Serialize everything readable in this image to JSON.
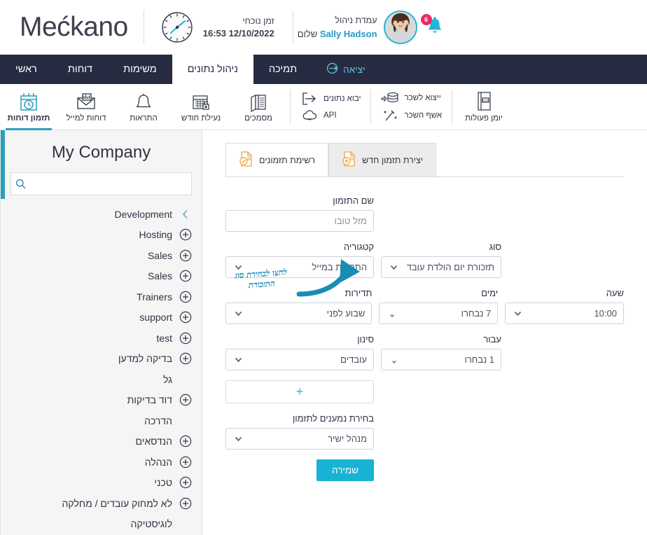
{
  "header": {
    "brand": "Mećkano",
    "clock": {
      "label": "זמן נוכחי",
      "value": "16:53 12/10/2022",
      "icon": "clock-icon"
    },
    "user": {
      "line1": "עמדת ניהול",
      "greeting": "שלום",
      "name": "Sally Hadson",
      "avatar_icon": "user-avatar",
      "bell_icon": "bell-icon",
      "notification_count": "6"
    }
  },
  "nav": {
    "items": [
      {
        "label": "ראשי",
        "active": false
      },
      {
        "label": "דוחות",
        "active": false
      },
      {
        "label": "משימות",
        "active": false
      },
      {
        "label": "ניהול נתונים",
        "active": true
      },
      {
        "label": "תמיכה",
        "active": false
      }
    ],
    "exit": {
      "label": "יציאה",
      "icon": "logout-icon"
    }
  },
  "toolbar": {
    "items": [
      {
        "label": "תזמון דוחות",
        "icon": "calendar-clock-icon",
        "active": true
      },
      {
        "label": "דוחות למייל",
        "icon": "mail-report-icon",
        "active": false
      },
      {
        "label": "התראות",
        "icon": "bell-icon",
        "active": false
      },
      {
        "label": "נעילת חודש",
        "icon": "calendar-lock-icon",
        "active": false
      },
      {
        "label": "מסמכים",
        "icon": "documents-icon",
        "active": false
      }
    ],
    "group_a": [
      {
        "label": "יבוא נתונים",
        "icon": "import-arrow-icon"
      },
      {
        "label": "API",
        "icon": "cloud-icon"
      }
    ],
    "group_b": [
      {
        "label": "ייצוא לשכר",
        "icon": "payroll-export-icon"
      },
      {
        "label": "אשף השכר",
        "icon": "magic-wand-icon"
      }
    ],
    "group_c": [
      {
        "label": "יומן פעולות",
        "icon": "log-book-icon"
      }
    ]
  },
  "tabs": [
    {
      "label": "יצירת תזמון חדש",
      "icon": "new-schedule-icon",
      "active": true
    },
    {
      "label": "רשימת תזמונים",
      "icon": "schedule-list-icon",
      "active": false
    }
  ],
  "form": {
    "name": {
      "label": "שם התזמון",
      "value": "",
      "placeholder": "מזל טובו"
    },
    "category": {
      "label": "קטגוריה",
      "value": "התראות במייל"
    },
    "type": {
      "label": "סוג",
      "value": "תזכורת יום הולדת עובד"
    },
    "frequency": {
      "label": "תדירות",
      "value": "שבוע לפני"
    },
    "days": {
      "label": "ימים",
      "value": "7 נבחרו"
    },
    "hour": {
      "label": "שעה",
      "value": "10:00"
    },
    "filter": {
      "label": "סינון",
      "value": "עובדים"
    },
    "for": {
      "label": "עבור",
      "value": "1 נבחרו"
    },
    "add_button": {
      "label": "+"
    },
    "recipients": {
      "label": "בחירת נמענים לתזמון",
      "value": "מנהל ישיר"
    },
    "save": {
      "label": "שמירה"
    }
  },
  "annotation": {
    "line1": "לחצו לבחירת סוג",
    "line2": "התזכורת",
    "icon": "curved-arrow-icon",
    "color": "#1b8cb5"
  },
  "sidebar": {
    "title": "My Company",
    "search": {
      "placeholder": "",
      "value": "",
      "icon": "search-icon"
    },
    "tree": [
      {
        "label": "Development",
        "icon": "chevron-left-icon",
        "ltr": true
      },
      {
        "label": "Hosting",
        "icon": "plus-circle-icon",
        "ltr": true
      },
      {
        "label": "Sales",
        "icon": "plus-circle-icon",
        "ltr": true
      },
      {
        "label": "Sales",
        "icon": "plus-circle-icon",
        "ltr": true
      },
      {
        "label": "Trainers",
        "icon": "plus-circle-icon",
        "ltr": true
      },
      {
        "label": "support",
        "icon": "plus-circle-icon",
        "ltr": true
      },
      {
        "label": "test",
        "icon": "plus-circle-icon",
        "ltr": true
      },
      {
        "label": "בדיקה למדען",
        "icon": "plus-circle-icon",
        "ltr": false
      },
      {
        "label": "גל",
        "icon": "none",
        "ltr": false
      },
      {
        "label": "דוד בדיקות",
        "icon": "plus-circle-icon",
        "ltr": false
      },
      {
        "label": "הדרכה",
        "icon": "none",
        "ltr": false
      },
      {
        "label": "הנדסאים",
        "icon": "plus-circle-icon",
        "ltr": false
      },
      {
        "label": "הנהלה",
        "icon": "plus-circle-icon",
        "ltr": false
      },
      {
        "label": "טכני",
        "icon": "plus-circle-icon",
        "ltr": false
      },
      {
        "label": "לא למחוק עובדים / מחלקה",
        "icon": "plus-circle-icon",
        "ltr": false
      },
      {
        "label": "לוגיסטיקה",
        "icon": "none",
        "ltr": false
      }
    ]
  },
  "colors": {
    "nav_bg": "#262b42",
    "accent_teal": "#2b9fba",
    "save_blue": "#18b2d4",
    "badge_pink": "#ec2a67",
    "tab_icon_orange": "#f2a43a",
    "annotation_blue": "#1b8cb5"
  }
}
